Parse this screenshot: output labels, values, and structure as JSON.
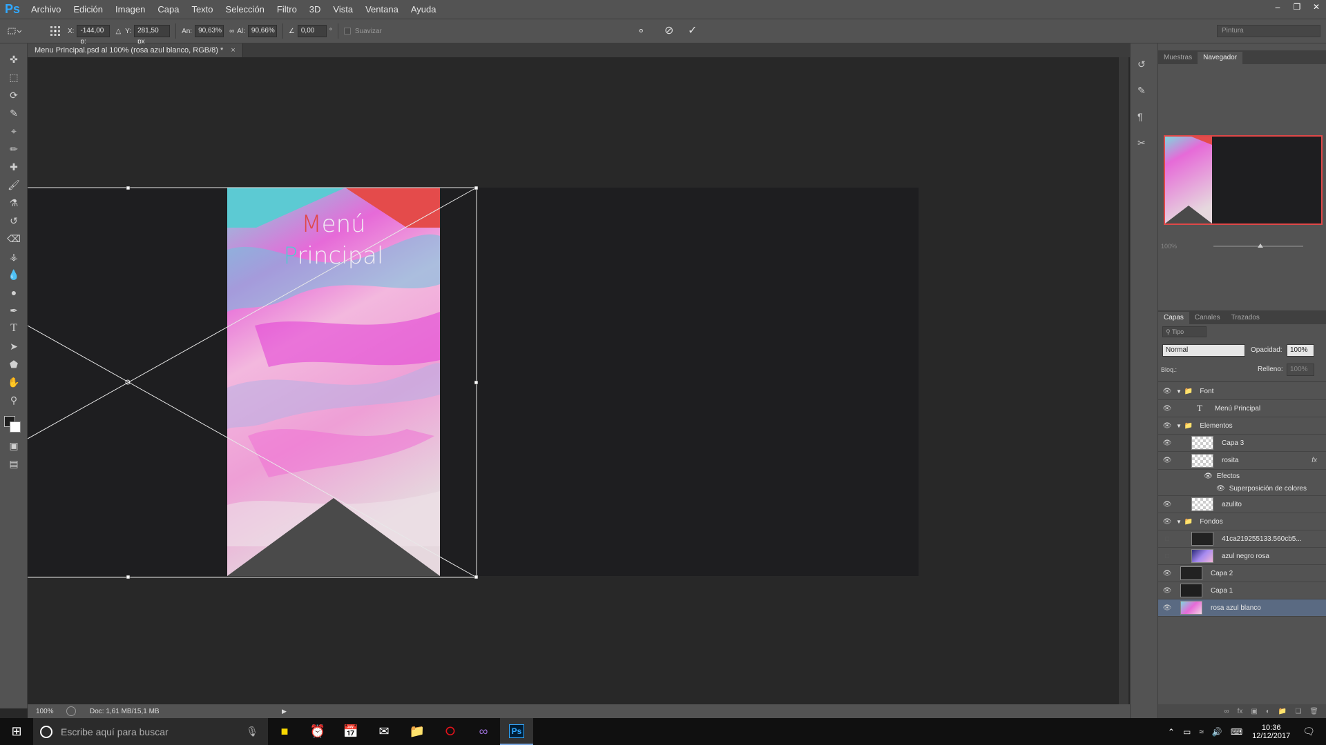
{
  "app": {
    "logo": "Ps"
  },
  "menu": [
    "Archivo",
    "Edición",
    "Imagen",
    "Capa",
    "Texto",
    "Selección",
    "Filtro",
    "3D",
    "Vista",
    "Ventana",
    "Ayuda"
  ],
  "options": {
    "x_label": "X:",
    "x_value": "-144,00 p:",
    "y_label": "Y:",
    "y_value": "281,50 px",
    "w_label": "An:",
    "w_value": "90,63%",
    "h_label": "Al:",
    "h_value": "90,66%",
    "angle_value": "0,00",
    "angle_unit": "°",
    "smooth_label": "Suavizar",
    "workspace_select": "Pintura"
  },
  "document": {
    "tab_title": "Menu Principal.psd al 100% (rosa azul blanco, RGB/8) *",
    "tab_close": "×",
    "title_line1": "Menú",
    "title_line2": "Principal"
  },
  "status": {
    "zoom": "100%",
    "doc_info": "Doc: 1,61 MB/15,1 MB"
  },
  "panels": {
    "top_tabs": [
      "Muestras",
      "Navegador"
    ],
    "nav_zoom": "100%",
    "layer_tabs": [
      "Capas",
      "Canales",
      "Trazados"
    ],
    "filter_kind": "Tipo",
    "blend_mode": "Normal",
    "opacity_label": "Opacidad:",
    "opacity_value": "100%",
    "lock_label": "Bloq.:",
    "fill_label": "Relleno:",
    "fill_value": "100%"
  },
  "layers": [
    {
      "name": "Font",
      "type": "group",
      "visible": true
    },
    {
      "name": "Menú Principal",
      "type": "text",
      "visible": true
    },
    {
      "name": "Elementos",
      "type": "group",
      "visible": true
    },
    {
      "name": "Capa 3",
      "type": "layer",
      "visible": true
    },
    {
      "name": "rosita",
      "type": "layer",
      "visible": true,
      "fx": "fx"
    },
    {
      "name": "Efectos",
      "type": "effects",
      "visible": true
    },
    {
      "name": "Superposición de colores",
      "type": "effect",
      "visible": true
    },
    {
      "name": "azulito",
      "type": "layer",
      "visible": true
    },
    {
      "name": "Fondos",
      "type": "group",
      "visible": true
    },
    {
      "name": "41ca219255133.560cb5...",
      "type": "smart",
      "visible": false
    },
    {
      "name": "azul negro rosa",
      "type": "smart",
      "visible": false
    },
    {
      "name": "Capa 2",
      "type": "layer",
      "visible": true
    },
    {
      "name": "Capa 1",
      "type": "layer",
      "visible": true
    },
    {
      "name": "rosa azul blanco",
      "type": "smart",
      "visible": true,
      "selected": true
    }
  ],
  "taskbar": {
    "search_placeholder": "Escribe aquí para buscar",
    "time": "10:36",
    "date": "12/12/2017"
  }
}
